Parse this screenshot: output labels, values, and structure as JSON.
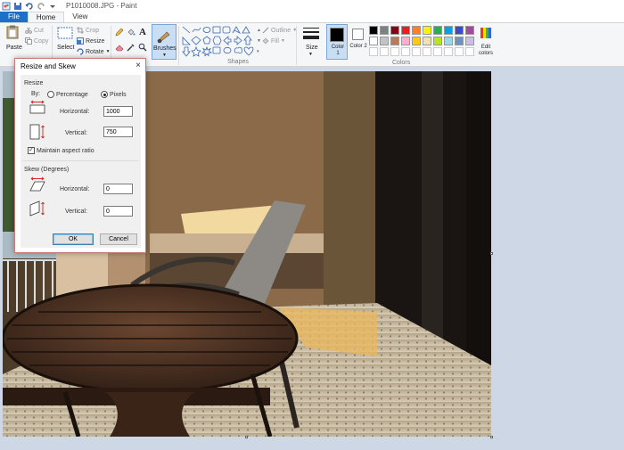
{
  "window": {
    "title": "P1010008.JPG - Paint"
  },
  "tabs": [
    {
      "label": "File"
    },
    {
      "label": "Home"
    },
    {
      "label": "View"
    }
  ],
  "clipboard": {
    "paste": "Paste",
    "cut": "Cut",
    "copy": "Copy"
  },
  "image_group": {
    "select": "Select",
    "crop": "Crop",
    "resize": "Resize",
    "rotate": "Rotate"
  },
  "tools": {
    "text_icon": "A"
  },
  "brushes": {
    "label": "Brushes"
  },
  "shapes": {
    "outline": "Outline",
    "fill": "Fill",
    "group_label": "Shapes"
  },
  "size": {
    "label": "Size"
  },
  "colors": {
    "color1_label": "Color 1",
    "color2_label": "Color 2",
    "edit_label": "Edit colors",
    "group_label": "Colors",
    "color1": "#000000",
    "color2": "#ffffff",
    "palette_row1": [
      "#000000",
      "#7f7f7f",
      "#880015",
      "#ed1c24",
      "#ff7f27",
      "#fff200",
      "#22b14c",
      "#00a2e8",
      "#3f48cc",
      "#a349a4"
    ],
    "palette_row2": [
      "#ffffff",
      "#c3c3c3",
      "#b97a57",
      "#ffaec9",
      "#ffc90e",
      "#efe4b0",
      "#b5e61d",
      "#99d9ea",
      "#7092be",
      "#c8bfe7"
    ]
  },
  "dialog": {
    "title": "Resize and Skew",
    "close": "×",
    "resize_section": "Resize",
    "by_label": "By:",
    "percentage": "Percentage",
    "pixels": "Pixels",
    "horizontal_label": "Horizontal:",
    "vertical_label": "Vertical:",
    "horizontal_value": "1000",
    "vertical_value": "750",
    "maintain": "Maintain aspect ratio",
    "skew_section": "Skew (Degrees)",
    "skew_horizontal_label": "Horizontal:",
    "skew_vertical_label": "Vertical:",
    "skew_horizontal_value": "0",
    "skew_vertical_value": "0",
    "ok": "OK",
    "cancel": "Cancel"
  }
}
